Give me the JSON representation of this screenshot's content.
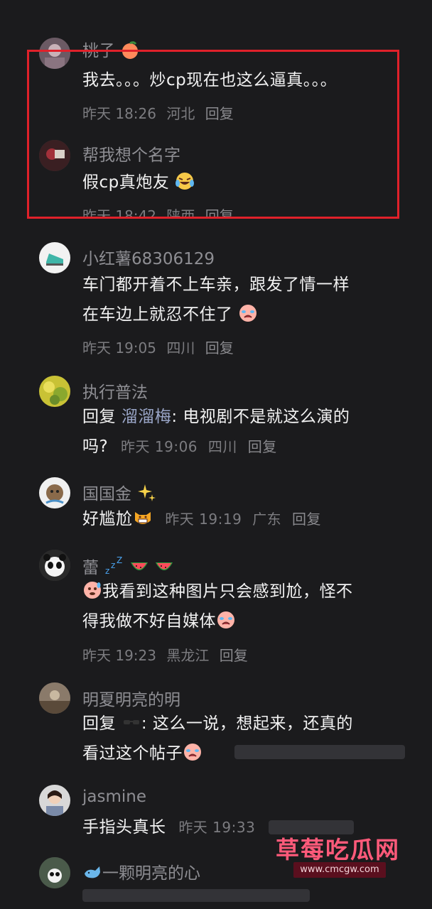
{
  "comments": [
    {
      "name": "桃子",
      "text": "我去。。。炒cp现在也这么逼真。。。",
      "date": "昨天 18:26",
      "location": "河北",
      "reply": "回复"
    },
    {
      "name": "帮我想个名字",
      "text": "假cp真炮友",
      "date": "昨天 18:42",
      "location": "陕西",
      "reply": "回复"
    },
    {
      "name": "小红薯68306129",
      "text_line1": "车门都开着不上车亲，跟发了情一样",
      "text_line2": "在车边上就忍不住了",
      "date": "昨天 19:05",
      "location": "四川",
      "reply": "回复"
    },
    {
      "name": "执行普法",
      "reply_prefix": "回复",
      "mention": "溜溜梅",
      "text_line1": ": 电视剧不是就这么演的",
      "text_line2": "吗?",
      "date": "昨天 19:06",
      "location": "四川",
      "reply": "回复"
    },
    {
      "name": "国国金",
      "text": "好尴尬",
      "date": "昨天 19:19",
      "location": "广东",
      "reply": "回复"
    },
    {
      "name": "蕾",
      "text_line1": "我看到这种图片只会感到尬，怪不",
      "text_line2": "得我做不好自媒体",
      "date": "昨天 19:23",
      "location": "黑龙江",
      "reply": "回复"
    },
    {
      "name": "明夏明亮的明",
      "reply_prefix": "回复",
      "text_line1": ": 这么一说，想起来，还真的",
      "text_line2": "看过这个帖子",
      "date": "",
      "location": "",
      "reply": ""
    },
    {
      "name": "jasmine",
      "text": "手指头真长",
      "date": "昨天 19:33"
    },
    {
      "name": "一颗明亮的心"
    }
  ],
  "watermark": {
    "title": "草莓吃瓜网",
    "url": "www.cmcgw.com"
  },
  "colors": {
    "background": "#1b1b1d",
    "highlight_border": "#e0212a",
    "watermark": "#ff5a7a"
  }
}
